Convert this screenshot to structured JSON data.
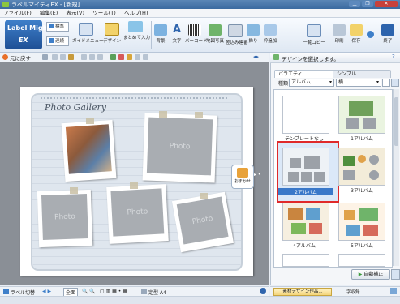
{
  "window": {
    "title": "ラベルマイティEX - [新規]"
  },
  "menu": [
    "ファイル(F)",
    "編集(E)",
    "表示(V)",
    "ツール(T)",
    "ヘルプ(H)"
  ],
  "ribbon": {
    "logo_line1": "Label Mighty",
    "logo_line2": "EX",
    "mode_standard": "標準",
    "mode_continuous": "連続",
    "guide_menu": "ガイドメニュー",
    "design": "デザイン",
    "batch_input": "まとめて入力",
    "buttons": [
      "背景",
      "文字",
      "バーコード",
      "地図写真",
      "差込み連番",
      "飾り",
      "枠追加",
      "一覧コピー",
      "印刷",
      "保存",
      "終了"
    ]
  },
  "subtoolbar": {
    "undo": "元に戻す"
  },
  "canvas": {
    "gallery_title": "Photo Gallery",
    "photo_label": "Photo",
    "omakase": "おまかせ"
  },
  "panel": {
    "header": "デザインを選択します。",
    "tabs": [
      "バラエティ",
      "シンプル"
    ],
    "kind_label": "種類",
    "kind_value": "アルバム",
    "second_value": "横",
    "thumbs": [
      {
        "label": "テンプレートなし",
        "selected": false
      },
      {
        "label": "1アルバム",
        "selected": false
      },
      {
        "label": "2アルバム",
        "selected": true
      },
      {
        "label": "3アルバム",
        "selected": false
      },
      {
        "label": "4アルバム",
        "selected": false
      },
      {
        "label": "5アルバム",
        "selected": false
      }
    ],
    "auto_button": "自動補正",
    "collect_button": "素材デザイン作品...",
    "collect_right": "字収録"
  },
  "status": {
    "label_switch": "ラベル切替",
    "zoom": "全面",
    "paper": "定型 A4"
  },
  "colors": {
    "accent": "#e02a2a",
    "ribbon_blue": "#2e64ad"
  }
}
